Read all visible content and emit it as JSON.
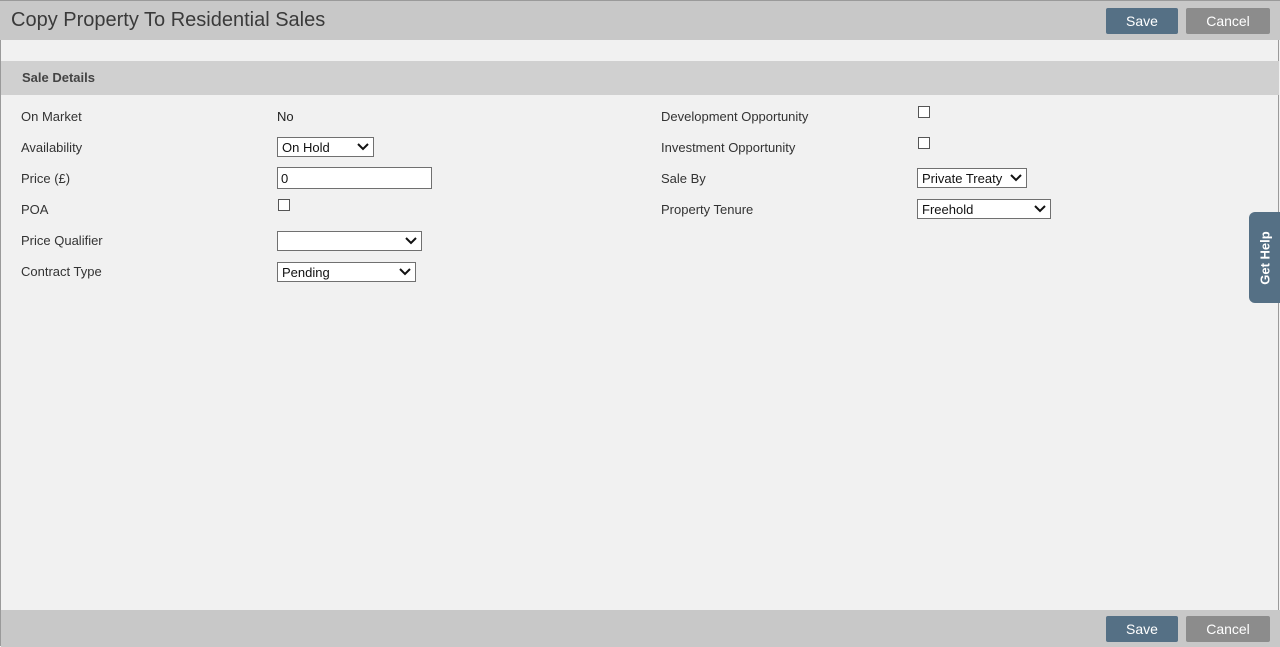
{
  "header": {
    "title": "Copy Property To Residential Sales",
    "save_label": "Save",
    "cancel_label": "Cancel"
  },
  "section": {
    "title": "Sale Details"
  },
  "left_fields": {
    "on_market": {
      "label": "On Market",
      "value": "No"
    },
    "availability": {
      "label": "Availability",
      "value": "On Hold"
    },
    "price": {
      "label": "Price (£)",
      "value": "0"
    },
    "poa": {
      "label": "POA",
      "checked": false
    },
    "price_qualifier": {
      "label": "Price Qualifier",
      "value": ""
    },
    "contract_type": {
      "label": "Contract Type",
      "value": "Pending"
    }
  },
  "right_fields": {
    "development_opportunity": {
      "label": "Development Opportunity",
      "checked": false
    },
    "investment_opportunity": {
      "label": "Investment Opportunity",
      "checked": false
    },
    "sale_by": {
      "label": "Sale By",
      "value": "Private Treaty"
    },
    "property_tenure": {
      "label": "Property Tenure",
      "value": "Freehold"
    }
  },
  "help": {
    "label": "Get Help"
  },
  "footer": {
    "save_label": "Save",
    "cancel_label": "Cancel"
  },
  "colors": {
    "save_button": "#557085",
    "cancel_button": "#8c8c8c",
    "bar": "#c8c8c8",
    "section_header": "#d0d0d0",
    "background": "#f1f1f1"
  },
  "icons": {
    "dropdown": "chevron-down-icon",
    "checkbox": "checkbox-unchecked"
  }
}
